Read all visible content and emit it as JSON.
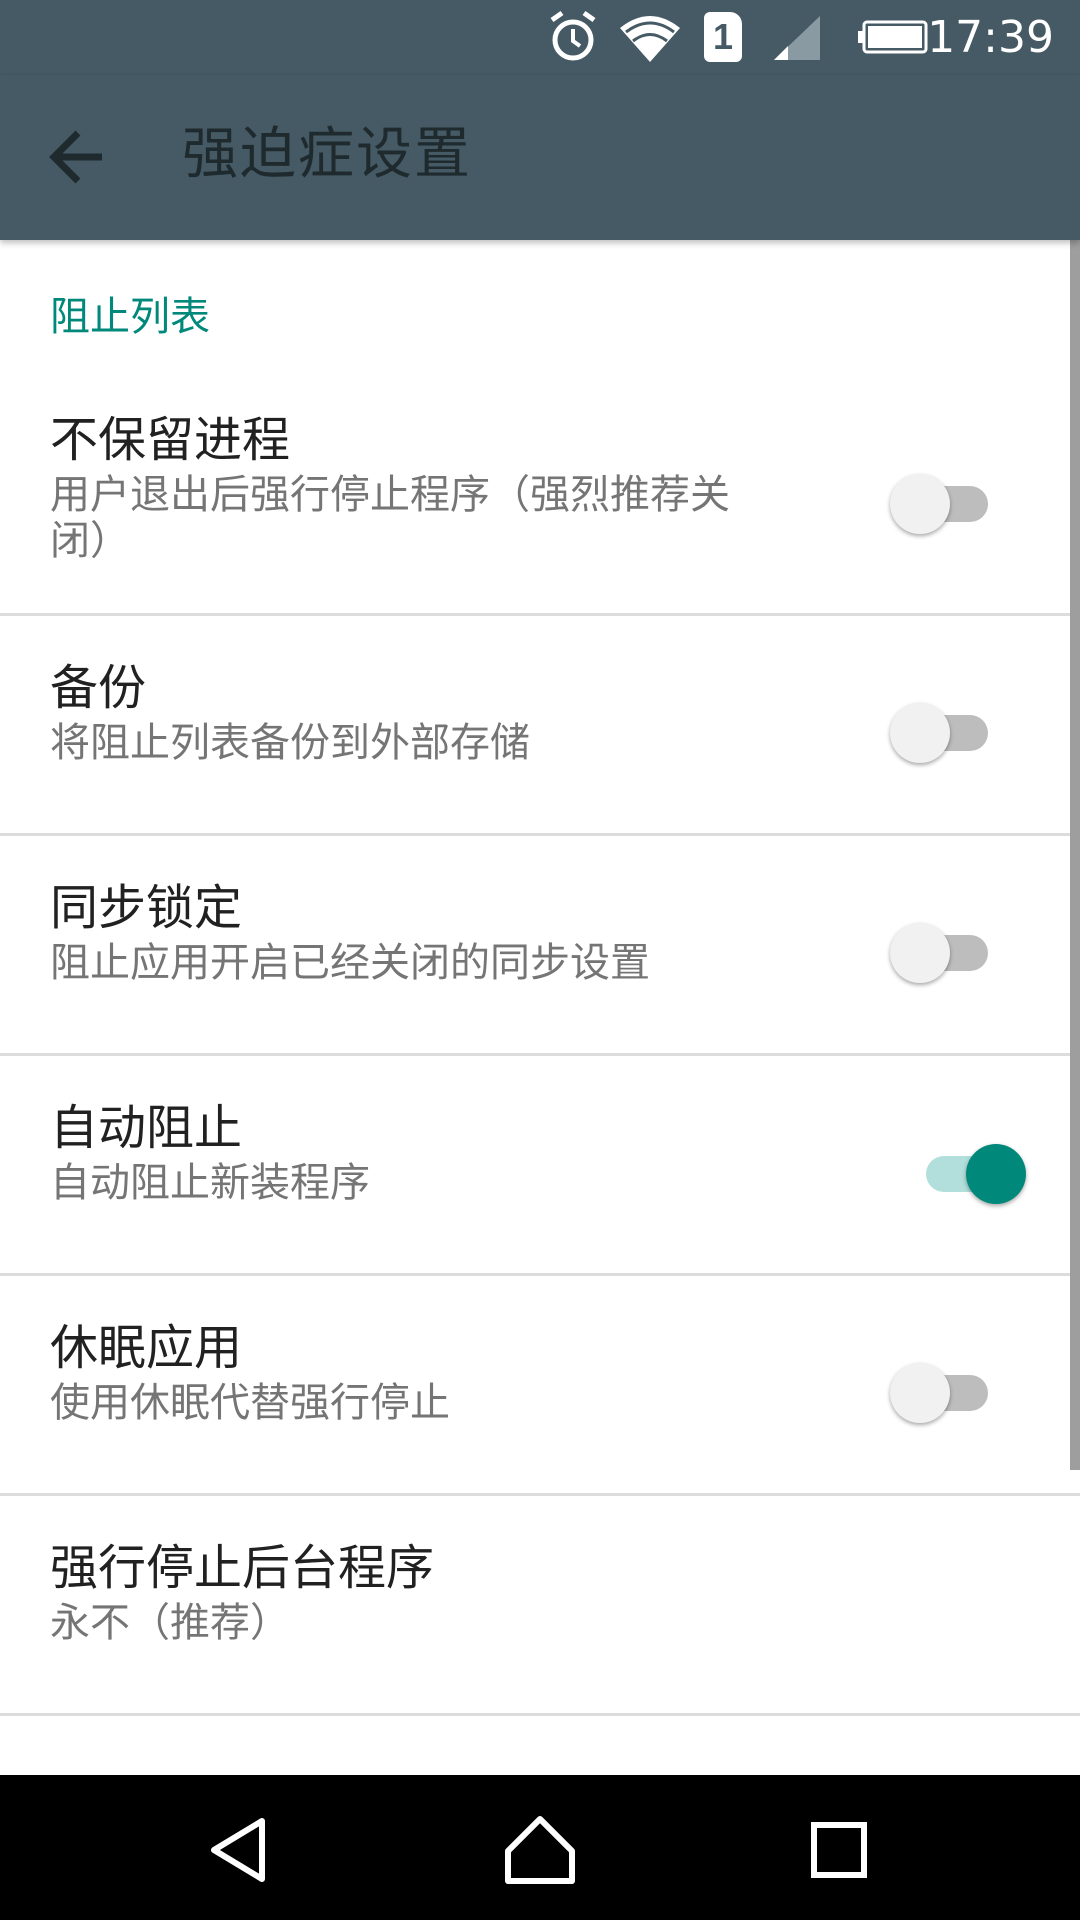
{
  "status_bar": {
    "time": "17:39",
    "sim_label": "1",
    "icons": [
      "alarm-icon",
      "wifi-icon",
      "sim-icon",
      "signal-icon",
      "battery-icon"
    ]
  },
  "toolbar": {
    "title": "强迫症设置",
    "back_icon": "arrow-back-icon"
  },
  "section": {
    "header": "阻止列表"
  },
  "preferences": [
    {
      "title": "不保留进程",
      "summary": "用户退出后强行停止程序（强烈推荐关闭）",
      "switch": false
    },
    {
      "title": "备份",
      "summary": "将阻止列表备份到外部存储",
      "switch": false
    },
    {
      "title": "同步锁定",
      "summary": "阻止应用开启已经关闭的同步设置",
      "switch": false
    },
    {
      "title": "自动阻止",
      "summary": "自动阻止新装程序",
      "switch": true
    },
    {
      "title": "休眠应用",
      "summary": "使用休眠代替强行停止",
      "switch": false
    },
    {
      "title": "强行停止后台程序",
      "summary": "永不（推荐）"
    }
  ],
  "colors": {
    "toolbar": "#455a64",
    "accent": "#00897b",
    "accent_light": "#b2dfdb",
    "nav_bar": "#000000"
  },
  "nav_bar": {
    "icons": [
      "nav-back-icon",
      "nav-home-icon",
      "nav-recents-icon"
    ]
  }
}
